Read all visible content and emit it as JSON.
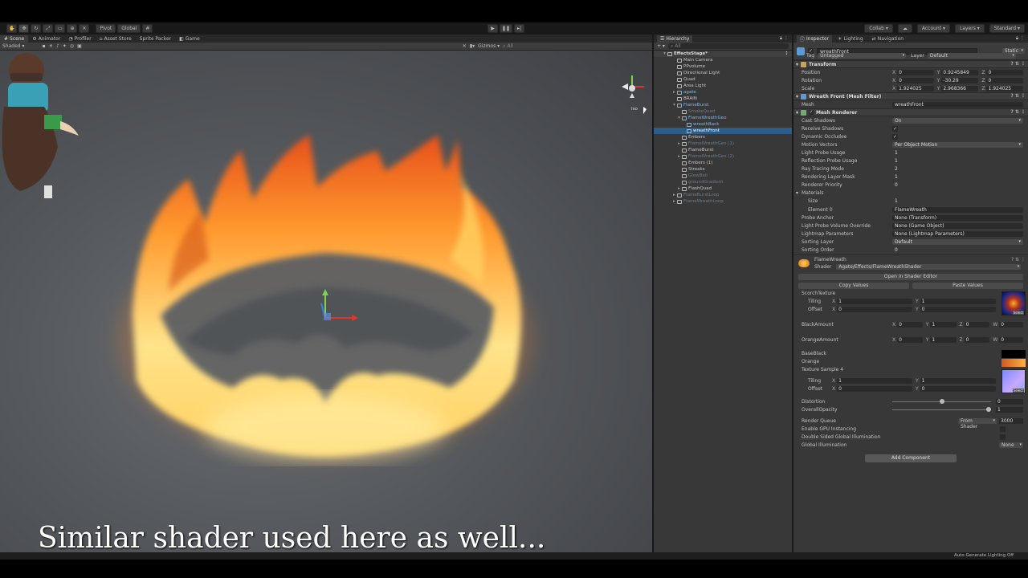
{
  "toolbar": {
    "tools": [
      "hand-icon",
      "move-icon",
      "rotate-icon",
      "scale-icon",
      "rect-icon",
      "transform-icon",
      "custom-icon"
    ],
    "pivot": "Pivot",
    "global": "Global",
    "collab": "Collab",
    "account": "Account",
    "layers": "Layers",
    "layout": "Standard"
  },
  "scene_tabs": [
    {
      "label": "Scene",
      "icon": "hash-icon",
      "active": true
    },
    {
      "label": "Animator",
      "icon": "animator-icon",
      "active": false
    },
    {
      "label": "Profiler",
      "icon": "profiler-icon",
      "active": false
    },
    {
      "label": "Asset Store",
      "icon": "store-icon",
      "active": false
    },
    {
      "label": "Sprite Packer",
      "icon": "",
      "active": false
    },
    {
      "label": "Game",
      "icon": "game-icon",
      "active": false
    }
  ],
  "scene_toolbar": {
    "shading": "Shaded",
    "gizmos": "Gizmos",
    "search": "All"
  },
  "gizmo_label": "Iso",
  "caption": "Similar shader used here as well...",
  "hierarchy": {
    "title": "Hierarchy",
    "search": "All",
    "rows": [
      {
        "label": "EffectsStage*",
        "indent": 0,
        "arrow": "▾",
        "type": "scene"
      },
      {
        "label": "Main Camera",
        "indent": 2,
        "arrow": "",
        "type": "normal"
      },
      {
        "label": "PPvolume",
        "indent": 2,
        "arrow": "",
        "type": "normal"
      },
      {
        "label": "Directional Light",
        "indent": 2,
        "arrow": "",
        "type": "normal"
      },
      {
        "label": "Quad",
        "indent": 2,
        "arrow": "",
        "type": "normal"
      },
      {
        "label": "Area Light",
        "indent": 2,
        "arrow": "",
        "type": "normal"
      },
      {
        "label": "agate",
        "indent": 2,
        "arrow": "▸",
        "type": "prefab"
      },
      {
        "label": "BRAIN",
        "indent": 2,
        "arrow": "",
        "type": "normal"
      },
      {
        "label": "FlameBurst",
        "indent": 2,
        "arrow": "▾",
        "type": "prefab"
      },
      {
        "label": "SmokeQuad",
        "indent": 3,
        "arrow": "",
        "type": "disabled"
      },
      {
        "label": "FlameWreathGeo",
        "indent": 3,
        "arrow": "▾",
        "type": "prefab"
      },
      {
        "label": "wreathBack",
        "indent": 4,
        "arrow": "",
        "type": "prefab"
      },
      {
        "label": "wreathFront",
        "indent": 4,
        "arrow": "",
        "type": "selected"
      },
      {
        "label": "Embers",
        "indent": 3,
        "arrow": "",
        "type": "normal"
      },
      {
        "label": "FlameWreathGeo (1)",
        "indent": 3,
        "arrow": "▸",
        "type": "disabled"
      },
      {
        "label": "FlameBurst",
        "indent": 3,
        "arrow": "",
        "type": "normal"
      },
      {
        "label": "FlameWreathGeo (2)",
        "indent": 3,
        "arrow": "▸",
        "type": "disabled"
      },
      {
        "label": "Embers (1)",
        "indent": 3,
        "arrow": "",
        "type": "normal"
      },
      {
        "label": "Streaks",
        "indent": 3,
        "arrow": "",
        "type": "normal"
      },
      {
        "label": "GlowBall",
        "indent": 3,
        "arrow": "",
        "type": "disabled"
      },
      {
        "label": "groundGradient",
        "indent": 3,
        "arrow": "",
        "type": "disabled"
      },
      {
        "label": "FlashQuad",
        "indent": 3,
        "arrow": "▸",
        "type": "normal"
      },
      {
        "label": "FlameBurstLoop",
        "indent": 2,
        "arrow": "▸",
        "type": "disabled"
      },
      {
        "label": "FlameWreathLoop",
        "indent": 2,
        "arrow": "▸",
        "type": "disabled"
      }
    ]
  },
  "inspector": {
    "tabs": [
      "Inspector",
      "Lighting",
      "Navigation"
    ],
    "object_name": "wreathFront",
    "static_label": "Static",
    "tag_label": "Tag",
    "tag_value": "Untagged",
    "layer_label": "Layer",
    "layer_value": "Default",
    "transform": {
      "title": "Transform",
      "position": {
        "label": "Position",
        "x": "0",
        "y": "0.9245849",
        "z": "0"
      },
      "rotation": {
        "label": "Rotation",
        "x": "0",
        "y": "-30.29",
        "z": "0"
      },
      "scale": {
        "label": "Scale",
        "x": "1.924025",
        "y": "2.968366",
        "z": "1.924025"
      }
    },
    "mesh_filter": {
      "title": "Wreath Front (Mesh Filter)",
      "mesh_label": "Mesh",
      "mesh_value": "wreathFront"
    },
    "mesh_renderer": {
      "title": "Mesh Renderer",
      "rows": [
        {
          "label": "Cast Shadows",
          "kind": "dropdown",
          "value": "On"
        },
        {
          "label": "Receive Shadows",
          "kind": "check",
          "value": "✓"
        },
        {
          "label": "Dynamic Occludee",
          "kind": "check",
          "value": "✓"
        },
        {
          "label": "Motion Vectors",
          "kind": "dropdown",
          "value": "Per Object Motion"
        },
        {
          "label": "Light Probe Usage",
          "kind": "text",
          "value": "1"
        },
        {
          "label": "Reflection Probe Usage",
          "kind": "text",
          "value": "1"
        },
        {
          "label": "Ray Tracing Mode",
          "kind": "text",
          "value": "2"
        },
        {
          "label": "Rendering Layer Mask",
          "kind": "text",
          "value": "1"
        },
        {
          "label": "Renderer Priority",
          "kind": "text",
          "value": "0"
        },
        {
          "label": "Materials",
          "kind": "none",
          "value": ""
        },
        {
          "label": "Size",
          "kind": "text",
          "value": "1"
        },
        {
          "label": "Element 0",
          "kind": "field",
          "value": "FlameWreath"
        },
        {
          "label": "Probe Anchor",
          "kind": "field",
          "value": "None (Transform)"
        },
        {
          "label": "Light Probe Volume Override",
          "kind": "field",
          "value": "None (Game Object)"
        },
        {
          "label": "Lightmap Parameters",
          "kind": "field",
          "value": "None (Lightmap Parameters)"
        },
        {
          "label": "Sorting Layer",
          "kind": "dropdown",
          "value": "Default"
        },
        {
          "label": "Sorting Order",
          "kind": "text",
          "value": "0"
        }
      ]
    },
    "material": {
      "name": "FlameWreath",
      "shader_label": "Shader",
      "shader_value": "Agate/Effects/FlameWreathShader",
      "open_shader": "Open in Shader Editor",
      "copy_values": "Copy Values",
      "paste_values": "Paste Values",
      "scorch_texture": "ScorchTexture",
      "tiling_label": "Tiling",
      "offset_label": "Offset",
      "tiling_x": "1",
      "tiling_y": "1",
      "offset_x": "0",
      "offset_y": "0",
      "black_amount": {
        "label": "BlackAmount",
        "x": "0",
        "y": "1",
        "z": "0",
        "w": "0"
      },
      "orange_amount": {
        "label": "OrangeAmount",
        "x": "0",
        "y": "1",
        "z": "0",
        "w": "0"
      },
      "base_black": "BaseBlack",
      "orange": "Orange",
      "texture_sample": "Texture Sample 4",
      "tiling2_x": "1",
      "tiling2_y": "1",
      "offset2_x": "0",
      "offset2_y": "0",
      "distortion": {
        "label": "Distortion",
        "value": "0",
        "fraction": 0.5
      },
      "overall_opacity": {
        "label": "OverallOpacity",
        "value": "1",
        "fraction": 1.0
      },
      "render_queue": {
        "label": "Render Queue",
        "mode": "From Shader",
        "value": "3000"
      },
      "gpu_instancing": "Enable GPU Instancing",
      "double_sided_gi": "Double Sided Global Illumination",
      "global_illumination": {
        "label": "Global Illumination",
        "value": "None"
      },
      "select_label": "Select"
    },
    "add_component": "Add Component"
  },
  "status": "Auto Generate Lighting Off"
}
